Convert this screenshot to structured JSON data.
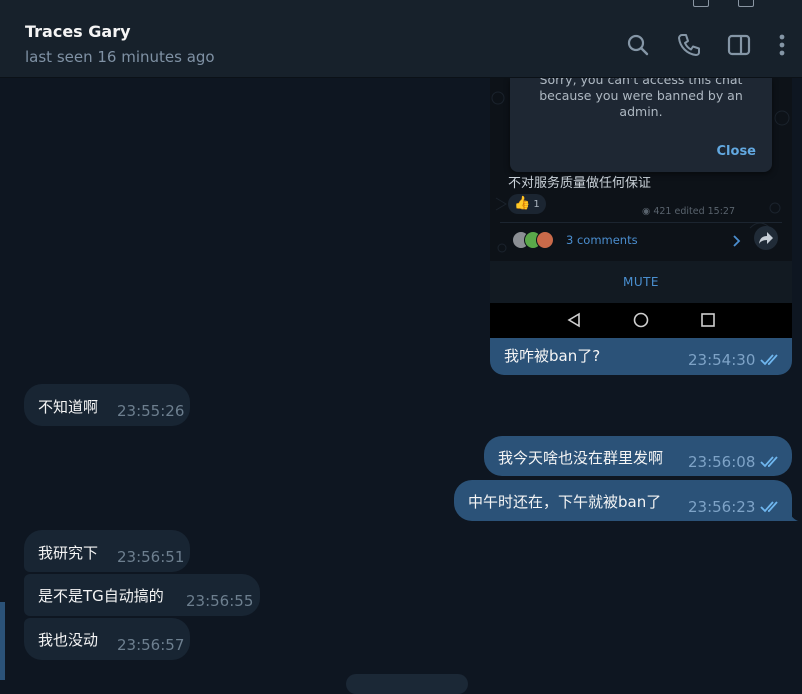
{
  "chat": {
    "name": "Traces Gary",
    "status": "last seen 16 minutes ago"
  },
  "header_icons": [
    "search-icon",
    "phone-icon",
    "sidebar-toggle-icon",
    "more-vertical-icon"
  ],
  "attachment": {
    "dialog_text": "Sorry, you can't access this chat because you were banned by an admin.",
    "dialog_button": "Close",
    "post_text": "不对服务质量做任何保证",
    "reaction_count": "1",
    "views": "421",
    "edited": "edited 15:27",
    "comments": "3 comments",
    "mute": "MUTE"
  },
  "messages": [
    {
      "dir": "out",
      "text": "我咋被ban了?",
      "time": "23:54:30"
    },
    {
      "dir": "in",
      "text": "不知道啊",
      "time": "23:55:26"
    },
    {
      "dir": "out",
      "text": "我今天啥也没在群里发啊",
      "time": "23:56:08"
    },
    {
      "dir": "out",
      "text": "中午时还在，下午就被ban了",
      "time": "23:56:23"
    },
    {
      "dir": "in",
      "text": "我研究下",
      "time": "23:56:51"
    },
    {
      "dir": "in",
      "text": "是不是TG自动搞的",
      "time": "23:56:55"
    },
    {
      "dir": "in",
      "text": "我也没动",
      "time": "23:56:57"
    }
  ],
  "colors": {
    "background": "#0e1621",
    "header": "#17212b",
    "outgoing_bubble": "#2b5278",
    "incoming_bubble": "#182533",
    "accent": "#62a8e0"
  }
}
